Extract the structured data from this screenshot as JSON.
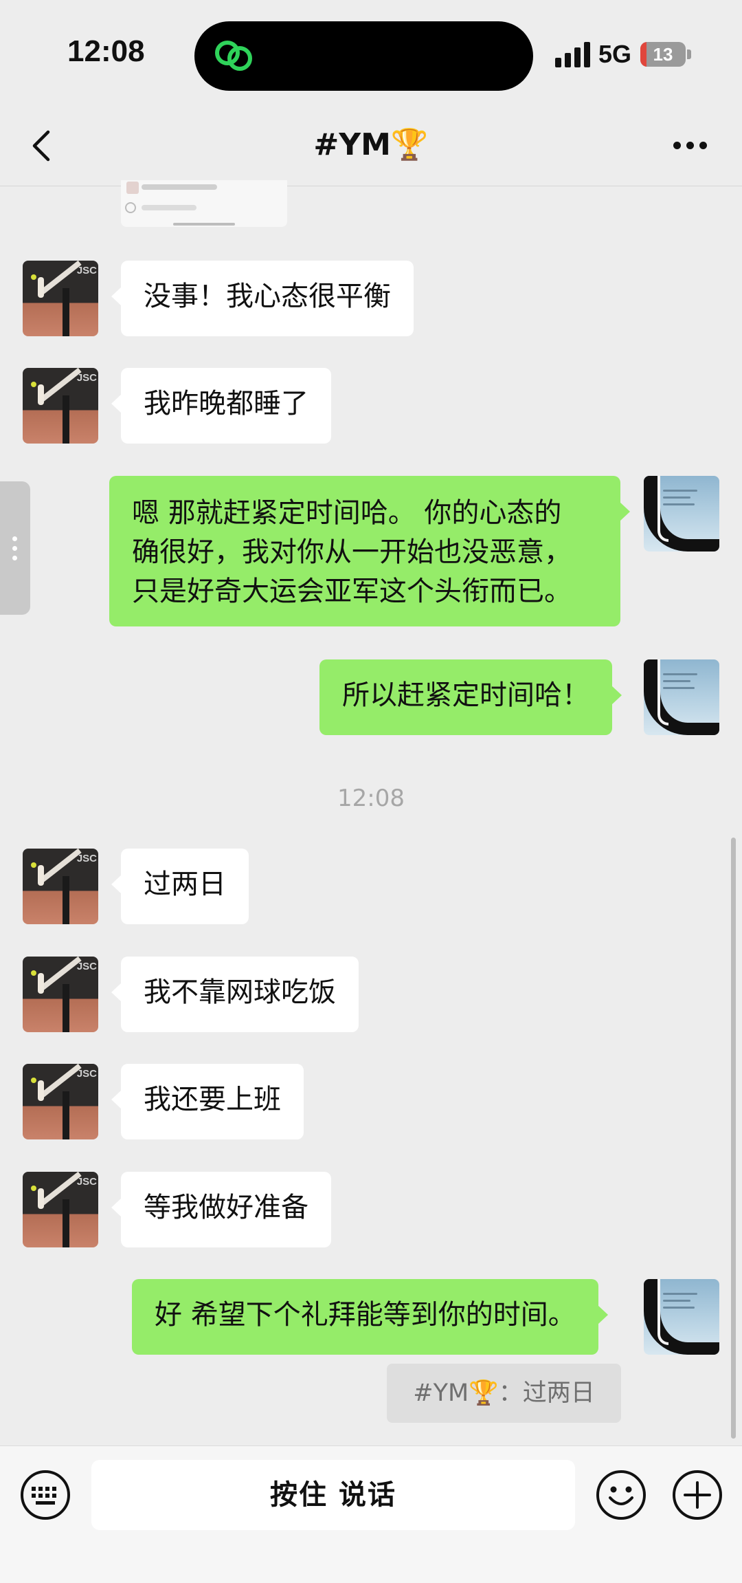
{
  "status_bar": {
    "time": "12:08",
    "network": "5G",
    "battery": "13",
    "battery_level_percent": 13,
    "signal_bars": 4
  },
  "header": {
    "title": "#YM🏆",
    "back_icon": "chevron-left-icon",
    "more_icon": "more-dots-icon"
  },
  "messages": [
    {
      "side": "in",
      "text": "没事！我心态很平衡"
    },
    {
      "side": "in",
      "text": "我昨晚都睡了"
    },
    {
      "side": "out",
      "lines": [
        "嗯 那就赶紧定时间哈。 你的心态的",
        "确很好，我对你从一开始也没恶意，",
        "只是好奇大运会亚军这个头衔而已。"
      ]
    },
    {
      "side": "out",
      "text": "所以赶紧定时间哈！"
    },
    {
      "side": "in",
      "text": "过两日"
    },
    {
      "side": "in",
      "text": "我不靠网球吃饭"
    },
    {
      "side": "in",
      "text": "我还要上班"
    },
    {
      "side": "in",
      "text": "等我做好准备"
    },
    {
      "side": "out",
      "text": "好 希望下个礼拜能等到你的时间。"
    }
  ],
  "timestamp": "12:08",
  "quote": "#YM🏆：过两日",
  "avatars": {
    "other_tag": "JSC"
  },
  "input_bar": {
    "voice_label": "按住 说话",
    "keyboard_icon": "keyboard-icon",
    "emoji_icon": "emoji-icon",
    "plus_icon": "plus-icon"
  },
  "colors": {
    "background": "#ededed",
    "bubble_out": "#95ec69",
    "bubble_in": "#ffffff"
  }
}
